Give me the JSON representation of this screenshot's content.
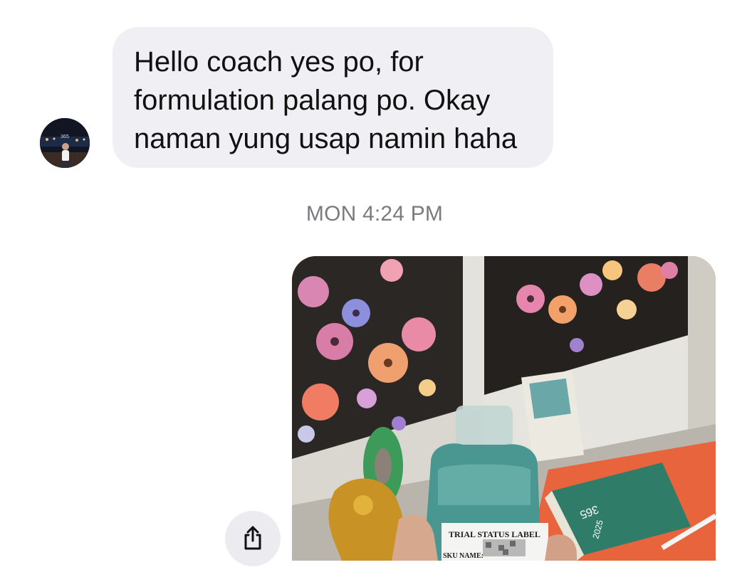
{
  "message_received": {
    "lines": [
      "Hello coach yes po, for",
      "formulation palang po. Okay",
      "naman yung usap namin haha"
    ]
  },
  "timestamp": "MON 4:24 PM",
  "photo": {
    "label_title": "TRIAL STATUS LABEL",
    "label_sku": "SKU NAME:",
    "book_text": "365",
    "book_year": "2025",
    "avatar_text": "365"
  },
  "colors": {
    "bubble_bg": "#efeff4",
    "timestamp": "#7a7a80",
    "share_button_bg": "#ececf0"
  },
  "icons": {
    "share": "share-icon"
  }
}
